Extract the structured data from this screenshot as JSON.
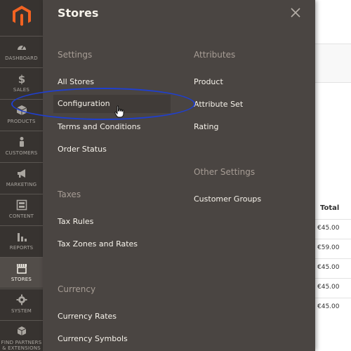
{
  "sidebar": {
    "items": [
      {
        "label": "DASHBOARD",
        "icon": "speedometer-icon"
      },
      {
        "label": "SALES",
        "icon": "dollar-icon"
      },
      {
        "label": "PRODUCTS",
        "icon": "cube-icon"
      },
      {
        "label": "CUSTOMERS",
        "icon": "person-icon"
      },
      {
        "label": "MARKETING",
        "icon": "megaphone-icon"
      },
      {
        "label": "CONTENT",
        "icon": "layout-icon"
      },
      {
        "label": "REPORTS",
        "icon": "bar-chart-icon"
      },
      {
        "label": "STORES",
        "icon": "storefront-icon"
      },
      {
        "label": "SYSTEM",
        "icon": "gear-icon"
      },
      {
        "label": "FIND PARTNERS & EXTENSIONS",
        "icon": "blocks-icon"
      }
    ],
    "active": "STORES"
  },
  "panel": {
    "title": "Stores",
    "settings": {
      "title": "Settings",
      "links": [
        "All Stores",
        "Configuration",
        "Terms and Conditions",
        "Order Status"
      ]
    },
    "taxes": {
      "title": "Taxes",
      "links": [
        "Tax Rules",
        "Tax Zones and Rates"
      ]
    },
    "currency": {
      "title": "Currency",
      "links": [
        "Currency Rates",
        "Currency Symbols"
      ]
    },
    "attributes": {
      "title": "Attributes",
      "links": [
        "Product",
        "Attribute Set",
        "Rating"
      ]
    },
    "other_settings": {
      "title": "Other Settings",
      "links": [
        "Customer Groups"
      ]
    }
  },
  "background_table": {
    "header": "Total",
    "values": [
      "€45.00",
      "€59.00",
      "€45.00",
      "€45.00",
      "€45.00"
    ]
  },
  "colors": {
    "sidebar_bg": "#373330",
    "panel_bg": "#4a4542",
    "highlight_ellipse": "#1f3fd0"
  }
}
